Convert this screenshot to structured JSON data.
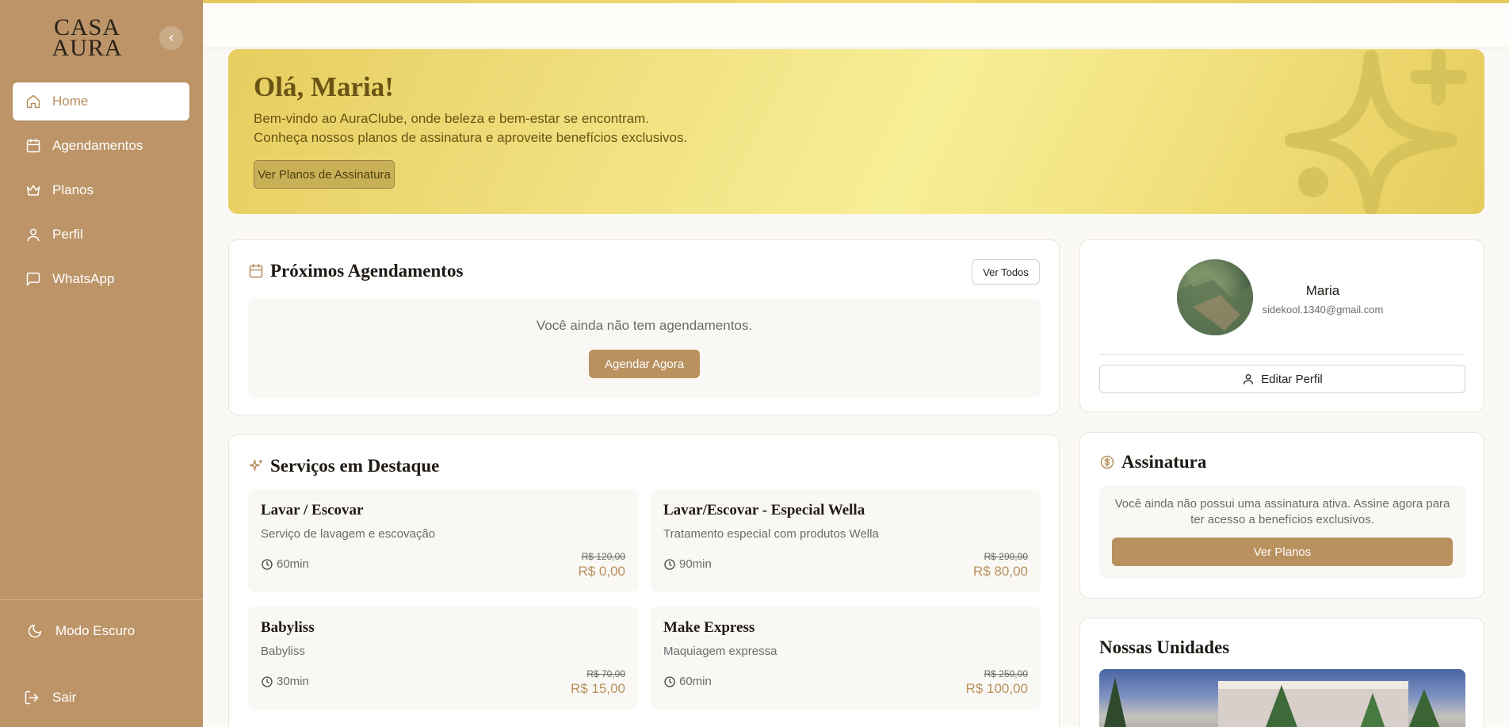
{
  "sidebar": {
    "logo_line1": "CASA",
    "logo_line2": "AURA",
    "items": [
      {
        "label": "Home",
        "icon": "home-icon"
      },
      {
        "label": "Agendamentos",
        "icon": "calendar-icon"
      },
      {
        "label": "Planos",
        "icon": "crown-icon"
      },
      {
        "label": "Perfil",
        "icon": "user-icon"
      },
      {
        "label": "WhatsApp",
        "icon": "chat-icon"
      }
    ],
    "dark_mode_label": "Modo Escuro",
    "logout_label": "Sair"
  },
  "hero": {
    "title": "Olá, Maria!",
    "line1": "Bem-vindo ao AuraClube, onde beleza e bem-estar se encontram.",
    "line2": "Conheça nossos planos de assinatura e aproveite benefícios exclusivos.",
    "button": "Ver Planos de Assinatura"
  },
  "appointments": {
    "title": "Próximos Agendamentos",
    "view_all": "Ver Todos",
    "empty_text": "Você ainda não tem agendamentos.",
    "schedule_button": "Agendar Agora"
  },
  "services": {
    "title": "Serviços em Destaque",
    "items": [
      {
        "name": "Lavar / Escovar",
        "desc": "Serviço de lavagem e escovação",
        "duration": "60min",
        "old_price": "R$ 120,00",
        "price": "R$ 0,00"
      },
      {
        "name": "Lavar/Escovar - Especial Wella",
        "desc": "Tratamento especial com produtos Wella",
        "duration": "90min",
        "old_price": "R$ 290,00",
        "price": "R$ 80,00"
      },
      {
        "name": "Babyliss",
        "desc": "Babyliss",
        "duration": "30min",
        "old_price": "R$ 70,00",
        "price": "R$ 15,00"
      },
      {
        "name": "Make Express",
        "desc": "Maquiagem expressa",
        "duration": "60min",
        "old_price": "R$ 250,00",
        "price": "R$ 100,00"
      }
    ]
  },
  "profile": {
    "name": "Maria",
    "email": "sidekool.1340@gmail.com",
    "edit_button": "Editar Perfil"
  },
  "subscription": {
    "title": "Assinatura",
    "text": "Você ainda não possui uma assinatura ativa. Assine agora para ter acesso a benefícios exclusivos.",
    "button": "Ver Planos"
  },
  "units": {
    "title": "Nossas Unidades"
  },
  "colors": {
    "sidebar": "#bc9467",
    "accent": "#b8915f",
    "hero_gold": "#f2e384"
  }
}
